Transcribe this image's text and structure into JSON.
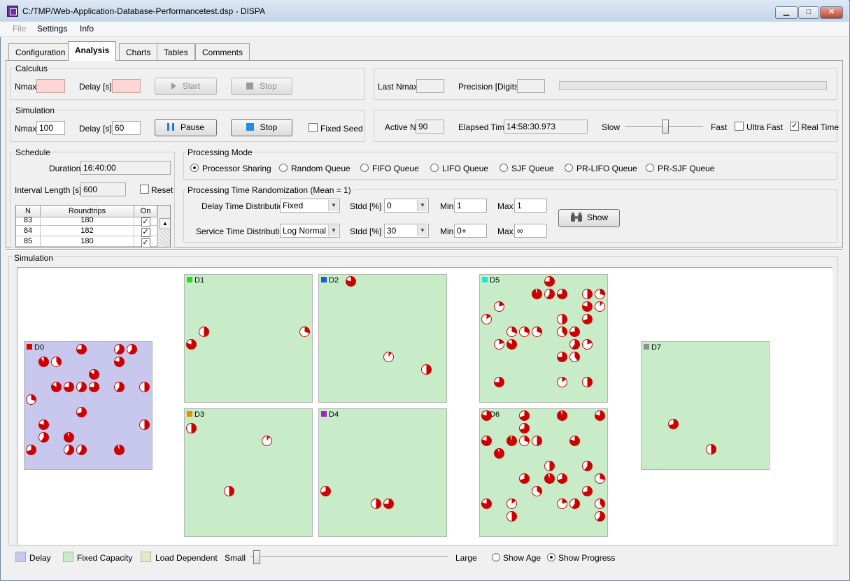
{
  "window": {
    "title": "C:/TMP/Web-Application-Database-Performancetest.dsp - DISPA",
    "min_glyph": "▁",
    "max_glyph": "□",
    "close_glyph": "✕"
  },
  "menu": [
    "File",
    "Settings",
    "Info"
  ],
  "tabs": [
    "Configuration",
    "Analysis",
    "Charts",
    "Tables",
    "Comments"
  ],
  "calculus": {
    "title": "Calculus",
    "nmax_label": "Nmax",
    "nmax": "",
    "delay_label": "Delay [s]",
    "delay": "",
    "start_label": "Start",
    "stop_label": "Stop"
  },
  "calc_info": {
    "last_nmax_label": "Last Nmax",
    "last_nmax": "",
    "precision_label": "Precision [Digits]",
    "precision": "",
    "progress": 0
  },
  "simulation": {
    "title": "Simulation",
    "nmax_label": "Nmax",
    "nmax": "100",
    "delay_label": "Delay [s]",
    "delay": "60",
    "pause_label": "Pause",
    "stop_label": "Stop",
    "fixed_seed_label": "Fixed Seed",
    "fixed_seed": false
  },
  "sim_info": {
    "active_n_label": "Active N",
    "active_n": "90",
    "elapsed_label": "Elapsed Time",
    "elapsed": "14:58:30.973",
    "slow_label": "Slow",
    "fast_label": "Fast",
    "speed": 0.52,
    "ultra_fast_label": "Ultra Fast",
    "ultra_fast": false,
    "real_time_label": "Real Time",
    "real_time": true
  },
  "schedule": {
    "title": "Schedule",
    "duration_label": "Duration",
    "duration": "16:40:00",
    "interval_label": "Interval Length [s]",
    "interval": "600",
    "reset_label": "Reset",
    "reset": false,
    "columns": [
      "N",
      "Roundtrips",
      "On"
    ],
    "rows": [
      {
        "n": "83",
        "roundtrips": "180",
        "on": "✓"
      },
      {
        "n": "84",
        "roundtrips": "182",
        "on": "✓"
      },
      {
        "n": "85",
        "roundtrips": "180",
        "on": "✓"
      }
    ]
  },
  "processing_mode": {
    "title": "Processing Mode",
    "options": [
      "Processor Sharing",
      "Random Queue",
      "FIFO Queue",
      "LIFO Queue",
      "SJF Queue",
      "PR-LIFO Queue",
      "PR-SJF Queue"
    ],
    "selected": "Processor Sharing"
  },
  "randomization": {
    "title": "Processing Time Randomization (Mean = 1)",
    "delay_dist_label": "Delay Time Distribution",
    "delay_dist": "Fixed",
    "service_dist_label": "Service Time Distribution",
    "service_dist": "Log Normal",
    "stdd_label": "Stdd [%]",
    "delay_stdd": "0",
    "service_stdd": "30",
    "min_label": "Min",
    "delay_min": "1",
    "service_min": "0+",
    "max_label": "Max",
    "delay_max": "1",
    "service_max": "∞",
    "show_label": "Show"
  },
  "sim_view": {
    "title": "Simulation",
    "stations": [
      {
        "name": "D0",
        "color": "#e00000",
        "fill": "#c8c8ee"
      },
      {
        "name": "D1",
        "color": "#22dd22",
        "fill": "#c8ecc8"
      },
      {
        "name": "D2",
        "color": "#1060e0",
        "fill": "#c8ecc8"
      },
      {
        "name": "D3",
        "color": "#f08a00",
        "fill": "#c8ecc8"
      },
      {
        "name": "D4",
        "color": "#a020d0",
        "fill": "#c8ecc8"
      },
      {
        "name": "D5",
        "color": "#20e0e0",
        "fill": "#c8ecc8"
      },
      {
        "name": "D6",
        "color": "#d0c000",
        "fill": "#c8ecc8"
      },
      {
        "name": "D7",
        "color": "#909090",
        "fill": "#c8ecc8"
      }
    ],
    "token_color": "#cc0000"
  },
  "legend": {
    "delay_label": "Delay",
    "delay_color": "#c8c8ee",
    "fixed_label": "Fixed Capacity",
    "fixed_color": "#c8ecc8",
    "load_label": "Load Dependent",
    "load_color": "#e0ecc0",
    "small_label": "Small",
    "large_label": "Large",
    "size": 0.0,
    "show_age_label": "Show Age",
    "show_progress_label": "Show Progress",
    "selected": "Show Progress"
  }
}
